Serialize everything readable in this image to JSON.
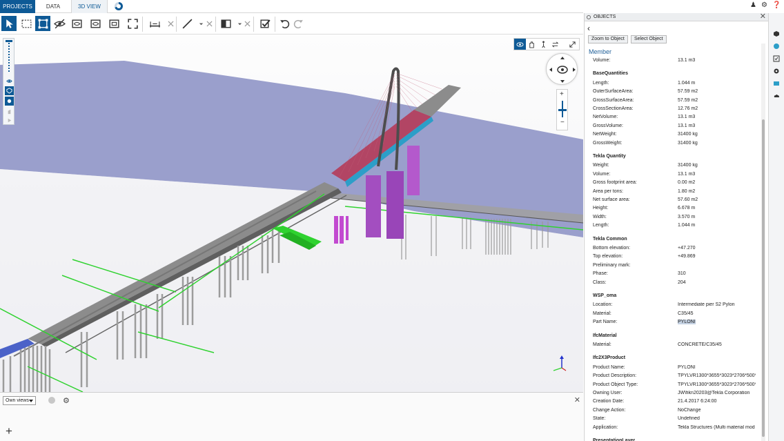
{
  "nav": {
    "tabs": [
      {
        "label": "PROJECTS"
      },
      {
        "label": "DATA"
      },
      {
        "label": "3D VIEW"
      }
    ]
  },
  "toolbar": {
    "icons": [
      "select-arrow-icon",
      "box-select-icon",
      "fit-select-icon",
      "hide-icon",
      "clip-icon",
      "section-icon",
      "view-icon",
      "fit-all-icon",
      "measure-icon",
      "line-icon",
      "clip-plane-icon",
      "approve-icon",
      "undo-icon",
      "redo-icon"
    ]
  },
  "bottom": {
    "views_select": "Own views"
  },
  "objects": {
    "header": "OBJECTS",
    "zoom_label": "Zoom to Object",
    "select_label": "Select Object",
    "title": "Member",
    "rows": [
      {
        "k": "Volume:",
        "v": "13.1 m3"
      },
      {
        "section": "BaseQuantities"
      },
      {
        "k": "Length:",
        "v": "1.044 m"
      },
      {
        "k": "OuterSurfaceArea:",
        "v": "57.59 m2"
      },
      {
        "k": "GrossSurfaceArea:",
        "v": "57.59 m2"
      },
      {
        "k": "CrossSectionArea:",
        "v": "12.76 m2"
      },
      {
        "k": "NetVolume:",
        "v": "13.1 m3"
      },
      {
        "k": "GrossVolume:",
        "v": "13.1 m3"
      },
      {
        "k": "NetWeight:",
        "v": "31400 kg"
      },
      {
        "k": "GrossWeight:",
        "v": "31400 kg"
      },
      {
        "section": "Tekla Quantity"
      },
      {
        "k": "Weight:",
        "v": "31400 kg"
      },
      {
        "k": "Volume:",
        "v": "13.1 m3"
      },
      {
        "k": "Gross footprint area:",
        "v": "0.00 m2"
      },
      {
        "k": "Area per tons:",
        "v": "1.80 m2"
      },
      {
        "k": "Net surface area:",
        "v": "57.60 m2"
      },
      {
        "k": "Height:",
        "v": "6.678 m"
      },
      {
        "k": "Width:",
        "v": "3.570 m"
      },
      {
        "k": "Length:",
        "v": "1.044 m"
      },
      {
        "section": "Tekla Common"
      },
      {
        "k": "Bottom elevation:",
        "v": "+47.270"
      },
      {
        "k": "Top elevation:",
        "v": "+49.869"
      },
      {
        "k": "Preliminary mark:",
        "v": ""
      },
      {
        "k": "Phase:",
        "v": "310"
      },
      {
        "k": "Class:",
        "v": "204"
      },
      {
        "section": "WSP_oma"
      },
      {
        "k": "Location:",
        "v": "Intermediate pier S2 Pylon"
      },
      {
        "k": "Material:",
        "v": "C35/45"
      },
      {
        "k": "Part Name:",
        "v": "PYLONI",
        "highlight": true
      },
      {
        "section": "IfcMaterial"
      },
      {
        "k": "Material:",
        "v": "CONCRETE/C35/45"
      },
      {
        "section": "Ifc2X3Product"
      },
      {
        "k": "Product Name:",
        "v": "PYLONI"
      },
      {
        "k": "Product Description:",
        "v": "TPYLVR1300*3655*3023*2706*500*75"
      },
      {
        "k": "Product Object Type:",
        "v": "TPYLVR1300*3655*3023*2706*500*75"
      },
      {
        "k": "Owning User:",
        "v": "JW\\fikn20203@Tekla Corporation"
      },
      {
        "k": "Creation Date:",
        "v": "21.4.2017 6:24:00"
      },
      {
        "k": "Change Action:",
        "v": "NoChange"
      },
      {
        "k": "State:",
        "v": "Undefined"
      },
      {
        "k": "Application:",
        "v": "Tekla Structures (Multi material mod"
      },
      {
        "section": "PresentationLayer"
      }
    ]
  },
  "colors": {
    "accent": "#0e5a96",
    "water": "#9a9fcc",
    "deck": "#8c8c8c",
    "pylon": "#a34a6a",
    "piers_magenta": "#b23cc8",
    "green": "#2fd22f"
  }
}
